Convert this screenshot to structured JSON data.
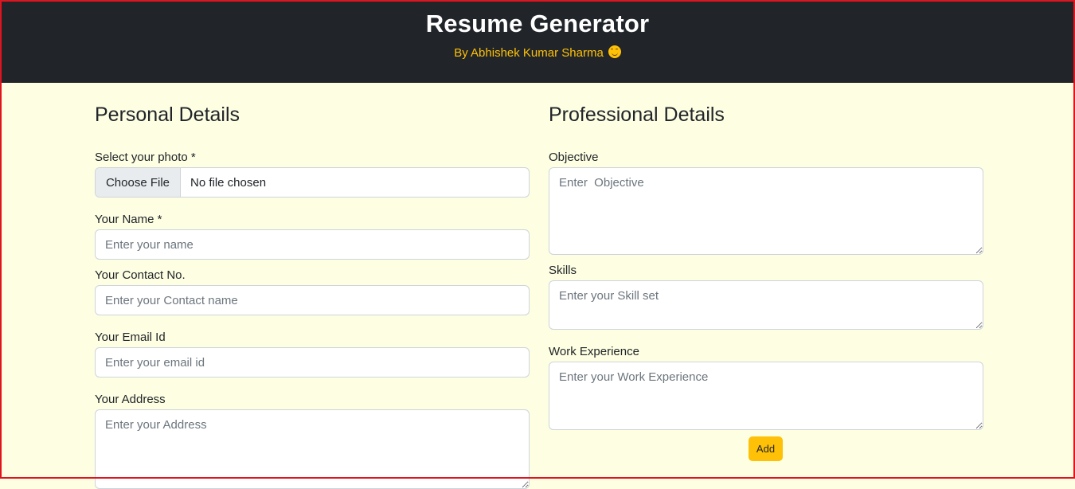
{
  "header": {
    "title": "Resume Generator",
    "byline": "By Abhishek Kumar Sharma",
    "emoji_icon": "smiling-face-icon"
  },
  "personal": {
    "heading": "Personal Details",
    "photo": {
      "label": "Select your photo *",
      "button": "Choose File",
      "status": "No file chosen"
    },
    "name": {
      "label": "Your Name *",
      "placeholder": "Enter your name"
    },
    "contact": {
      "label": "Your Contact No.",
      "placeholder": "Enter your Contact name"
    },
    "email": {
      "label": "Your Email Id",
      "placeholder": "Enter your email id"
    },
    "address": {
      "label": "Your Address",
      "placeholder": "Enter your Address"
    }
  },
  "professional": {
    "heading": "Professional Details",
    "objective": {
      "label": "Objective",
      "placeholder": "Enter  Objective"
    },
    "skills": {
      "label": "Skills",
      "placeholder": "Enter your Skill set"
    },
    "experience": {
      "label": "Work Experience",
      "placeholder": "Enter your Work Experience"
    },
    "add_button": "Add"
  },
  "colors": {
    "header_bg": "#212529",
    "accent": "#ffc107",
    "page_bg": "#fefee2",
    "frame": "#e0141e"
  }
}
